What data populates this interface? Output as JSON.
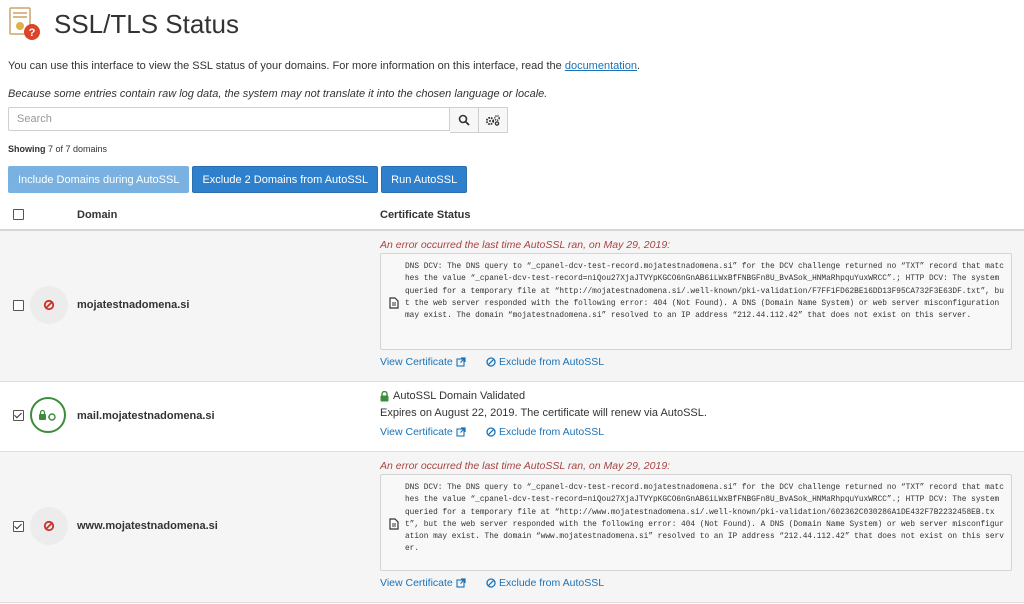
{
  "page": {
    "title": "SSL/TLS Status",
    "intro_text": "You can use this interface to view the SSL status of your domains. For more information on this interface, read the",
    "intro_link": "documentation",
    "intro_end": ".",
    "note": "Because some entries contain raw log data, the system may not translate it into the chosen language or locale."
  },
  "search": {
    "placeholder": "Search"
  },
  "showing": {
    "label": "Showing",
    "text": "7 of 7 domains"
  },
  "buttons": {
    "include": "Include Domains during AutoSSL",
    "exclude": "Exclude 2 Domains from AutoSSL",
    "run": "Run AutoSSL"
  },
  "table": {
    "headers": {
      "domain": "Domain",
      "cert": "Certificate Status"
    },
    "rows": [
      {
        "checked": false,
        "domain": "mojatestnadomena.si",
        "status": "error",
        "error_title": "An error occurred the last time AutoSSL ran, on May 29, 2019:",
        "log": "DNS DCV: The DNS query to “_cpanel-dcv-test-record.mojatestnadomena.si” for the DCV challenge returned no “TXT” record that matches the value “_cpanel-dcv-test-record=niQou27XjaJTVYpKGCO6nGnAB6iLWxBfFNBGFn8U_BvASok_HNMaRhpquYuxWRCC”.; HTTP DCV: The system queried for a temporary file at “http://mojatestnadomena.si/.well-known/pki-validation/F7FF1FD62BE16DD13F95CA732F3E63DF.txt”, but the web server responded with the following error: 404 (Not Found). A DNS (Domain Name System) or web server misconfiguration may exist. The domain “mojatestnadomena.si” resolved to an IP address “212.44.112.42” that does not exist on this server.",
        "view_cert": "View Certificate",
        "exclude": "Exclude from AutoSSL"
      },
      {
        "checked": true,
        "domain": "mail.mojatestnadomena.si",
        "status": "ok",
        "ok_title": "AutoSSL Domain Validated",
        "ok_sub": "Expires on August 22, 2019. The certificate will renew via AutoSSL.",
        "view_cert": "View Certificate",
        "exclude": "Exclude from AutoSSL"
      },
      {
        "checked": true,
        "domain": "www.mojatestnadomena.si",
        "status": "error",
        "error_title": "An error occurred the last time AutoSSL ran, on May 29, 2019:",
        "log": "DNS DCV: The DNS query to “_cpanel-dcv-test-record.mojatestnadomena.si” for the DCV challenge returned no “TXT” record that matches the value “_cpanel-dcv-test-record=niQou27XjaJTVYpKGCO6nGnAB6iLWxBfFNBGFn8U_BvASok_HNMaRhpquYuxWRCC”.; HTTP DCV: The system queried for a temporary file at “http://www.mojatestnadomena.si/.well-known/pki-validation/602362C030286A1DE432F7B2232458EB.txt”, but the web server responded with the following error: 404 (Not Found). A DNS (Domain Name System) or web server misconfiguration may exist. The domain “www.mojatestnadomena.si” resolved to an IP address “212.44.112.42” that does not exist on this server.",
        "view_cert": "View Certificate",
        "exclude": "Exclude from AutoSSL"
      }
    ]
  },
  "colors": {
    "primary": "#2f80cc",
    "primary_disabled": "#79b1e0",
    "error": "#a94442",
    "success": "#3c8c3c",
    "link": "#1a73b8"
  }
}
